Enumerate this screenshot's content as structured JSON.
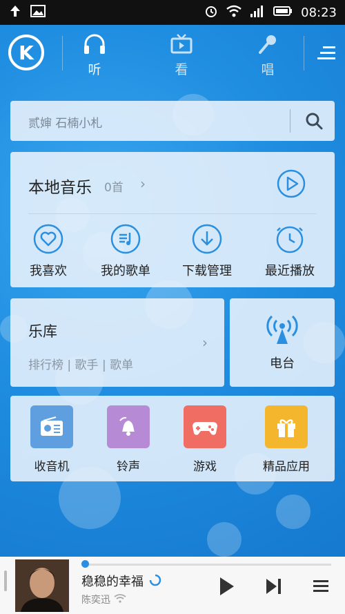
{
  "status_bar": {
    "time": "08:23"
  },
  "header": {
    "tabs": [
      {
        "label": "听",
        "icon": "headphones-icon"
      },
      {
        "label": "看",
        "icon": "tv-icon"
      },
      {
        "label": "唱",
        "icon": "microphone-icon"
      }
    ]
  },
  "search": {
    "placeholder": "贰婶 石楠小札"
  },
  "local_music": {
    "title": "本地音乐",
    "count": "0首",
    "actions": [
      {
        "label": "我喜欢",
        "icon": "heart-icon"
      },
      {
        "label": "我的歌单",
        "icon": "playlist-icon"
      },
      {
        "label": "下载管理",
        "icon": "download-icon"
      },
      {
        "label": "最近播放",
        "icon": "clock-icon"
      }
    ]
  },
  "library": {
    "title": "乐库",
    "subtitle": "排行榜 | 歌手 | 歌单"
  },
  "radio": {
    "label": "电台"
  },
  "apps": [
    {
      "label": "收音机",
      "icon": "radio-icon",
      "color": "#5f9fe0"
    },
    {
      "label": "铃声",
      "icon": "bell-icon",
      "color": "#b78ad6"
    },
    {
      "label": "游戏",
      "icon": "gamepad-icon",
      "color": "#ef6d62"
    },
    {
      "label": "精品应用",
      "icon": "gift-icon",
      "color": "#f3b62c"
    }
  ],
  "player": {
    "song": "稳稳的幸福",
    "artist": "陈奕迅"
  },
  "colors": {
    "accent": "#1f8de0",
    "card": "#ebf3fc"
  }
}
